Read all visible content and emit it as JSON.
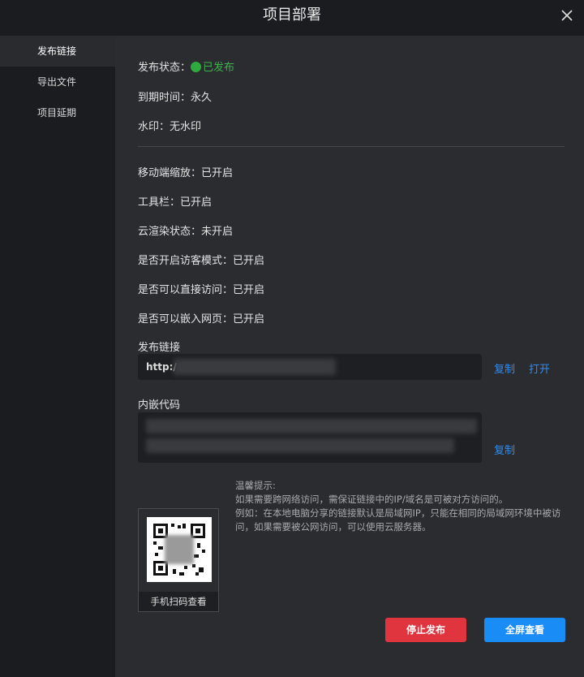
{
  "dialog": {
    "title": "项目部署"
  },
  "sidebar": {
    "items": [
      {
        "label": "发布链接"
      },
      {
        "label": "导出文件"
      },
      {
        "label": "项目延期"
      }
    ]
  },
  "status": {
    "publish_label": "发布状态：",
    "publish_value": "已发布",
    "expire_label": "到期时间：",
    "expire_value": "永久",
    "watermark_label": "水印：",
    "watermark_value": "无水印"
  },
  "settings": {
    "mobile_zoom_label": "移动端缩放：",
    "mobile_zoom_value": "已开启",
    "toolbar_label": "工具栏：",
    "toolbar_value": "已开启",
    "cloud_render_label": "云渲染状态：",
    "cloud_render_value": "未开启",
    "guest_mode_label": "是否开启访客模式：",
    "guest_mode_value": "已开启",
    "direct_access_label": "是否可以直接访问：",
    "direct_access_value": "已开启",
    "embed_label": "是否可以嵌入网页：",
    "embed_value": "已开启"
  },
  "publish_link": {
    "heading": "发布链接",
    "url_prefix": "http:/",
    "copy_label": "复制",
    "open_label": "打开"
  },
  "embed_code": {
    "heading": "内嵌代码",
    "copy_label": "复制"
  },
  "tips": {
    "title": "温馨提示:",
    "line1": "如果需要跨网络访问，需保证链接中的IP/域名是可被对方访问的。",
    "line2": "例如：在本地电脑分享的链接默认是局域网IP，只能在相同的局域网环境中被访问，如果需要被公网访问，可以使用云服务器。"
  },
  "qr": {
    "caption": "手机扫码查看"
  },
  "actions": {
    "stop_label": "停止发布",
    "fullscreen_label": "全屏查看"
  },
  "colors": {
    "accent": "#2f8cf0",
    "danger": "#e0353f",
    "primary": "#1a8cf5",
    "status_green": "#2eaa3f"
  }
}
